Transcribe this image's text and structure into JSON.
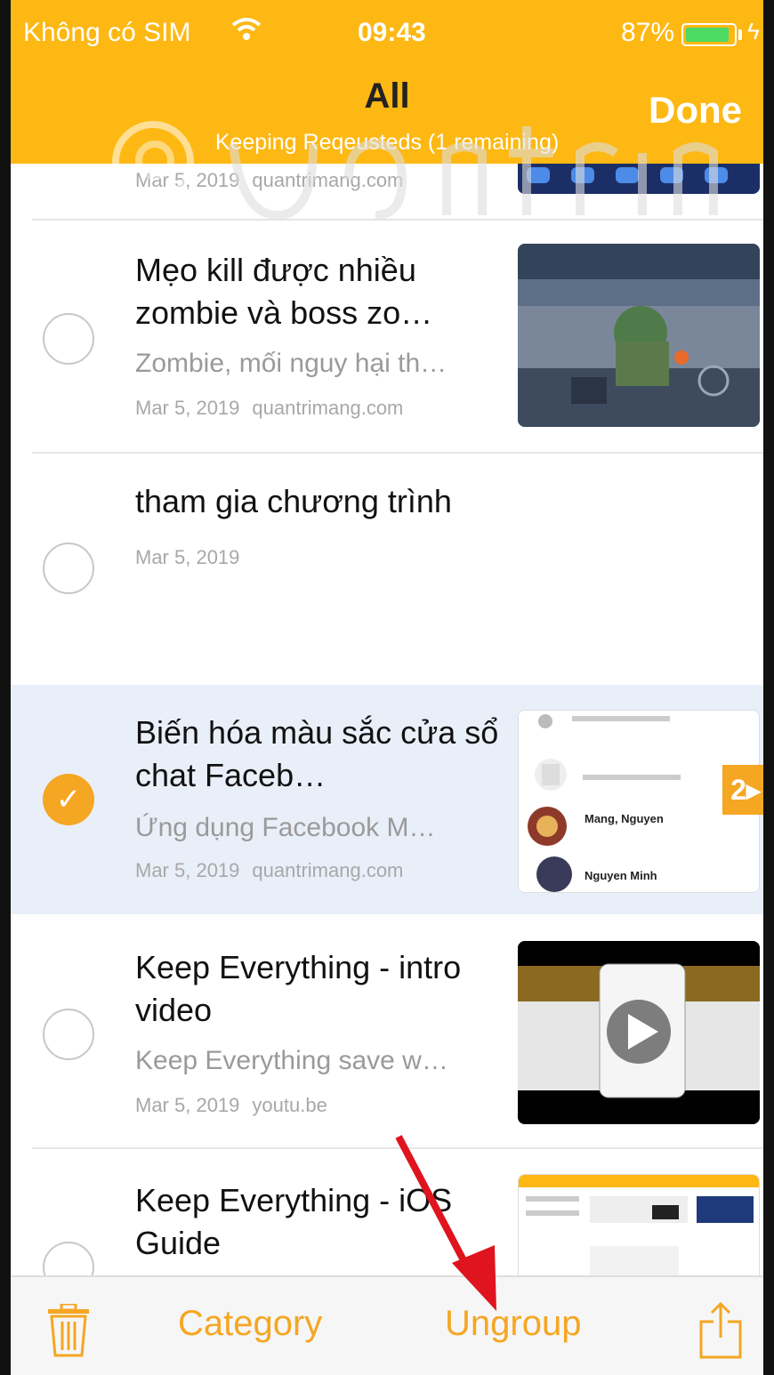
{
  "status": {
    "carrier": "Không có SIM",
    "time": "09:43",
    "battery": "87%"
  },
  "nav": {
    "title": "All",
    "subtitle": "Keeping Reqeusteds (1 remaining)",
    "done_label": "Done"
  },
  "items": [
    {
      "meta_date": "Mar 5, 2019",
      "meta_source": "quantrimang.com"
    },
    {
      "title": "Mẹo kill được nhiều zombie và boss zo…",
      "snippet": "Zombie, mối nguy hại th…",
      "meta_date": "Mar 5, 2019",
      "meta_source": "quantrimang.com"
    },
    {
      "title": "tham gia chương trình",
      "meta_date": "Mar 5, 2019"
    },
    {
      "title": "Biến hóa màu sắc cửa sổ chat Faceb…",
      "snippet": "Ứng dụng Facebook M…",
      "meta_date": "Mar 5, 2019",
      "meta_source": "quantrimang.com",
      "checked": true,
      "badge": "2▸"
    },
    {
      "title": "Keep Everything - intro video",
      "snippet": "Keep Everything save w…",
      "meta_date": "Mar 5, 2019",
      "meta_source": "youtu.be"
    },
    {
      "title": "Keep Everything - iOS Guide"
    }
  ],
  "thumb_text": {
    "fb_name_1": "Mang, Nguyen",
    "fb_name_2": "Nguyen Minh"
  },
  "toolbar": {
    "category_label": "Category",
    "ungroup_label": "Ungroup"
  },
  "icons": [
    "wifi-icon",
    "battery-icon",
    "checkmark-icon",
    "trash-icon",
    "share-icon",
    "play-icon"
  ],
  "colors": {
    "accent": "#FDB813",
    "action": "#F5A623",
    "selected_row": "#E9EFF9",
    "annotation_arrow": "#E0141E"
  }
}
